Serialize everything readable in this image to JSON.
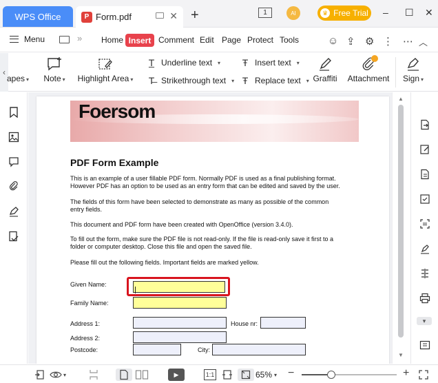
{
  "titlebar": {
    "app_tab": "WPS Office",
    "doc_tab": "Form.pdf",
    "doc_badge": "P",
    "new_tab": "+",
    "window_count": "1",
    "avatar_text": "AI",
    "free_trial": "Free Trial",
    "minimize": "–",
    "maximize": "☐",
    "close": "✕"
  },
  "menubar": {
    "menu": "Menu",
    "items": [
      "Home",
      "Insert",
      "Comment",
      "Edit",
      "Page",
      "Protect",
      "Tools"
    ],
    "active": "Insert"
  },
  "ribbon": {
    "shapes": "apes",
    "note": "Note",
    "highlight_area": "Highlight Area",
    "underline_text": "Underline text",
    "strikethrough_text": "Strikethrough text",
    "insert_text": "Insert text",
    "replace_text": "Replace text",
    "graffiti": "Graffiti",
    "attachment": "Attachment",
    "sign": "Sign"
  },
  "document": {
    "banner_title": "Foersom",
    "heading": "PDF Form Example",
    "paragraphs": [
      [
        "This is an example of a user fillable PDF form. Normally PDF is used as a final publishing format.",
        "However PDF has an option to be used as an entry form that can be edited and saved by the user."
      ],
      [
        "The fields of this form have been selected to demonstrate as many as possible of the common",
        "entry fields."
      ],
      [
        "This document and PDF form have been created with OpenOffice (version 3.4.0)."
      ],
      [
        "To fill out the form, make sure the PDF file is not read-only. If the file is read-only save it first to a",
        "folder or computer desktop. Close this file and open the saved file."
      ],
      [
        "Please fill out the following fields. Important fields are marked yellow."
      ]
    ],
    "fields": {
      "given_name": "Given Name:",
      "family_name": "Family Name:",
      "address1": "Address 1:",
      "house_nr": "House nr:",
      "address2": "Address 2:",
      "postcode": "Postcode:",
      "city": "City:"
    }
  },
  "statusbar": {
    "zoom": "65%",
    "zoom_fraction": 0.31,
    "minus": "−",
    "plus": "+",
    "fit_page": "1:1"
  }
}
